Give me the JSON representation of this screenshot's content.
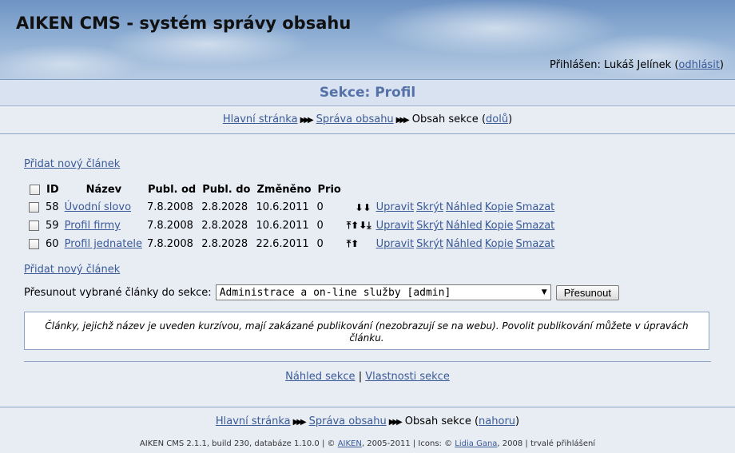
{
  "header": {
    "app_title": "AIKEN CMS - systém správy obsahu",
    "login_prefix": "Přihlášen: Lukáš Jelínek (",
    "logout_label": "odhlásit",
    "login_suffix": ")"
  },
  "section": {
    "title": "Sekce: Profil"
  },
  "breadcrumb": {
    "home": "Hlavní stránka",
    "content_admin": "Správa obsahu",
    "current": "Obsah sekce",
    "down_label": "dolů",
    "up_label": "nahoru",
    "paren_open": "(",
    "paren_close": ")"
  },
  "add_article_label": "Přidat nový článek",
  "table": {
    "headers": [
      "ID",
      "Název",
      "Publ. od",
      "Publ. do",
      "Změněno",
      "Prio"
    ],
    "rows": [
      {
        "id": "58",
        "name": "Úvodní slovo",
        "publ_from": "7.8.2008",
        "publ_to": "2.8.2028",
        "changed": "10.6.2011",
        "prio": "0",
        "arrows": "⬇⬇"
      },
      {
        "id": "59",
        "name": "Profil firmy",
        "publ_from": "7.8.2008",
        "publ_to": "2.8.2028",
        "changed": "10.6.2011",
        "prio": "0",
        "arrows": "⤒⬆⬇⤓"
      },
      {
        "id": "60",
        "name": "Profil jednatele",
        "publ_from": "7.8.2008",
        "publ_to": "2.8.2028",
        "changed": "22.6.2011",
        "prio": "0",
        "arrows": "⤒⬆"
      }
    ],
    "actions": [
      "Upravit",
      "Skrýt",
      "Náhled",
      "Kopie",
      "Smazat"
    ]
  },
  "move": {
    "label": "Přesunout vybrané články do sekce:",
    "selected_option": "Administrace a on-line služby [admin]",
    "button_label": "Přesunout"
  },
  "note": "Články, jejichž název je uveden kurzívou, mají zakázané publikování (nezobrazují se na webu). Povolit publikování můžete v úpravách článku.",
  "section_links": {
    "preview": "Náhled sekce",
    "separator": "|",
    "properties": "Vlastnosti sekce"
  },
  "footer": {
    "prefix": "AIKEN CMS 2.1.1, build 230, databáze 1.10.0 | © ",
    "aiken_link": "AIKEN",
    "middle": ", 2005-2011 | Icons: © ",
    "icons_link": "Lidia Gana",
    "suffix": ", 2008 | trvalé přihlášení"
  }
}
